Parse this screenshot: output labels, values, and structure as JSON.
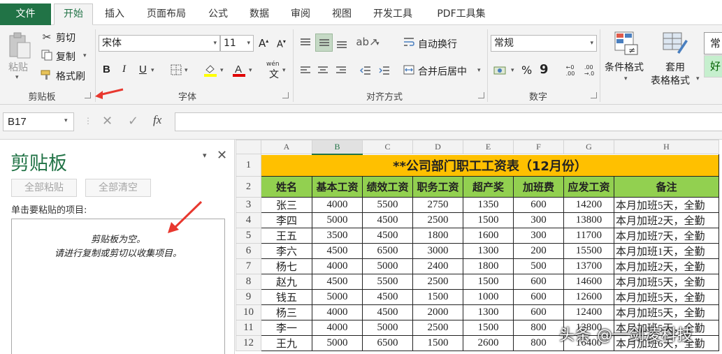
{
  "menu": {
    "tabs": [
      "文件",
      "开始",
      "插入",
      "页面布局",
      "公式",
      "数据",
      "审阅",
      "视图",
      "开发工具",
      "PDF工具集"
    ]
  },
  "ribbon": {
    "clipboard": {
      "paste": "粘贴",
      "cut": "剪切",
      "copy": "复制",
      "format_painter": "格式刷",
      "group_label": "剪贴板"
    },
    "font": {
      "name": "宋体",
      "size": "11",
      "bold": "B",
      "italic": "I",
      "underline": "U",
      "group_label": "字体",
      "grow": "A",
      "shrink": "A",
      "phonetic": "wén"
    },
    "alignment": {
      "wrap_text": "自动换行",
      "merge_center": "合并后居中",
      "group_label": "对齐方式"
    },
    "number": {
      "format": "常规",
      "percent": "%",
      "comma": "9",
      "group_label": "数字"
    },
    "styles": {
      "conditional": "条件格式",
      "table_format_1": "套用",
      "table_format_2": "表格格式",
      "normal": "常",
      "good": "好"
    }
  },
  "formula_bar": {
    "name_box": "B17",
    "fx": "fx",
    "value": ""
  },
  "clipboard_pane": {
    "title": "剪贴板",
    "paste_all": "全部粘贴",
    "clear_all": "全部清空",
    "hint": "单击要粘贴的项目:",
    "empty_line1": "剪贴板为空。",
    "empty_line2": "请进行复制或剪切以收集项目。"
  },
  "sheet": {
    "columns": [
      "A",
      "B",
      "C",
      "D",
      "E",
      "F",
      "G",
      "H"
    ],
    "title": "**公司部门职工工资表（12月份）",
    "headers": [
      "姓名",
      "基本工资",
      "绩效工资",
      "职务工资",
      "超产奖",
      "加班费",
      "应发工资",
      "备注"
    ],
    "rows": [
      [
        "张三",
        "4000",
        "5500",
        "2750",
        "1350",
        "600",
        "14200",
        "本月加班5天，全勤"
      ],
      [
        "李四",
        "5000",
        "4500",
        "2500",
        "1500",
        "300",
        "13800",
        "本月加班2天，全勤"
      ],
      [
        "王五",
        "3500",
        "4500",
        "1800",
        "1600",
        "300",
        "11700",
        "本月加班7天，全勤"
      ],
      [
        "李六",
        "4500",
        "6500",
        "3000",
        "1300",
        "200",
        "15500",
        "本月加班1天，全勤"
      ],
      [
        "杨七",
        "4000",
        "5000",
        "2400",
        "1800",
        "500",
        "13700",
        "本月加班2天，全勤"
      ],
      [
        "赵九",
        "4500",
        "5500",
        "2500",
        "1500",
        "600",
        "14600",
        "本月加班5天，全勤"
      ],
      [
        "钱五",
        "5000",
        "4500",
        "1500",
        "1000",
        "600",
        "12600",
        "本月加班5天，全勤"
      ],
      [
        "杨三",
        "4000",
        "4500",
        "2000",
        "1300",
        "600",
        "12400",
        "本月加班5天，全勤"
      ],
      [
        "李一",
        "4000",
        "5000",
        "2500",
        "1500",
        "800",
        "13800",
        "本月加班5天，全勤"
      ],
      [
        "王九",
        "5000",
        "6500",
        "1500",
        "2600",
        "800",
        "16400",
        "本月加班6天，全勤"
      ]
    ],
    "row_numbers": [
      "1",
      "2",
      "3",
      "4",
      "5",
      "6",
      "7",
      "8",
      "9",
      "10",
      "11",
      "12"
    ]
  },
  "watermark": "头条 @一剑凌科技",
  "colors": {
    "accent": "#217346",
    "title_fill": "#ffc000",
    "header_fill": "#92d050",
    "arrow": "#e8382f"
  }
}
